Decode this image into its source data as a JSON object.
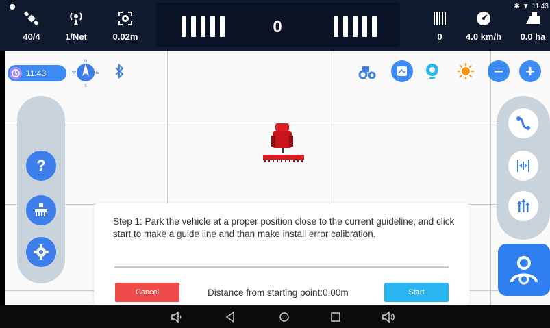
{
  "topbar": {
    "satellites": {
      "icon": "satellite-icon",
      "value": "40/4"
    },
    "network": {
      "icon": "antenna-icon",
      "value": "1/Net"
    },
    "accuracy": {
      "icon": "target-icon",
      "value": "0.02m"
    },
    "lightbar_value": "0",
    "row_count": {
      "icon": "rows-icon",
      "value": "0"
    },
    "speed": {
      "icon": "speedometer-icon",
      "value": "4.0 km/h"
    },
    "area": {
      "icon": "field-area-icon",
      "value": "0.0 ha"
    },
    "android_time": "11:43"
  },
  "map": {
    "clock_time": "11:43",
    "compass_labels": {
      "n": "N",
      "s": "S",
      "e": "E",
      "w": "W"
    }
  },
  "tools": {
    "top": [
      "tractor-icon",
      "map-layers-icon",
      "location-icon",
      "brightness-icon",
      "zoom-out-icon",
      "zoom-in-icon"
    ],
    "left": [
      "help-icon",
      "implement-icon",
      "settings-icon"
    ],
    "right": [
      "guideline-curve-icon",
      "ab-line-icon",
      "adjust-icon"
    ],
    "help_label": "?"
  },
  "dialog": {
    "message": "Step 1: Park the vehicle at a proper position close to the current guideline, and click start to make a guide line and than make install error calibration.",
    "cancel_label": "Cancel",
    "distance_text": "Distance from starting point:0.00m",
    "start_label": "Start"
  },
  "colors": {
    "accent": "#3d7eea",
    "cancel": "#ef4b4b",
    "start": "#2bb5f0",
    "topbar": "#0f1a2e"
  }
}
